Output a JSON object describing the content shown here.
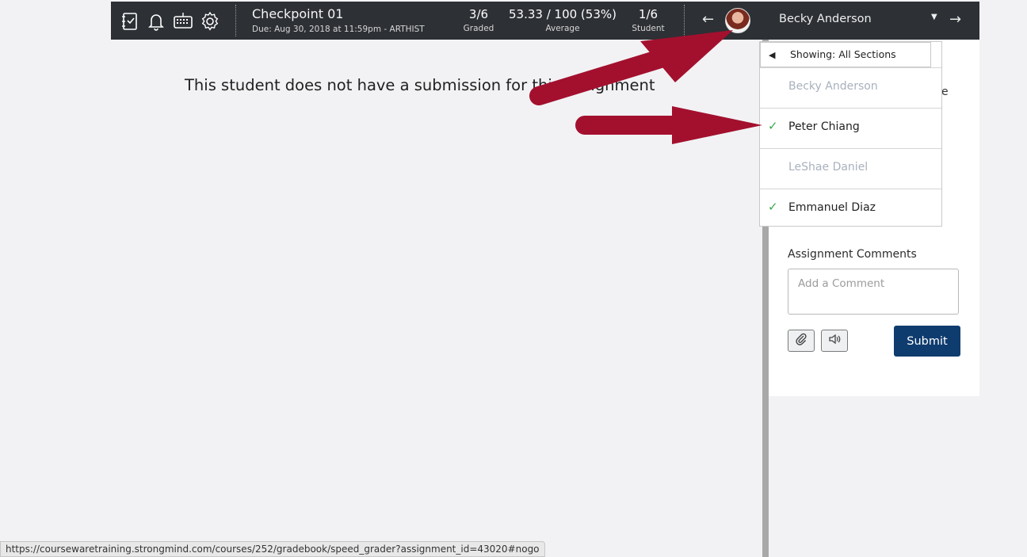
{
  "assignment": {
    "title": "Checkpoint 01",
    "due": "Due: Aug 30, 2018 at 11:59pm - ARTHIST"
  },
  "stats": [
    {
      "value": "3/6",
      "label": "Graded"
    },
    {
      "value": "53.33 / 100 (53%)",
      "label": "Average"
    },
    {
      "value": "1/6",
      "label": "Student"
    }
  ],
  "student": {
    "name": "Becky Anderson"
  },
  "main": {
    "message": "This student does not have a submission for this assignment"
  },
  "dropdown": {
    "header": "Showing: All Sections",
    "items": [
      {
        "name": "Becky Anderson",
        "checked": false,
        "dim": true
      },
      {
        "name": "Peter Chiang",
        "checked": true,
        "dim": false
      },
      {
        "name": "LeShae Daniel",
        "checked": false,
        "dim": true
      },
      {
        "name": "Emmanuel Diaz",
        "checked": true,
        "dim": false
      }
    ]
  },
  "comments": {
    "label": "Assignment Comments",
    "placeholder": "Add a Comment",
    "submit_label": "Submit"
  },
  "right_panel": {
    "partial_text": "e"
  },
  "statusbar": {
    "url": "https://coursewaretraining.strongmind.com/courses/252/gradebook/speed_grader?assignment_id=43020#nogo"
  },
  "colors": {
    "topbar": "#2d3035",
    "submit": "#0f3c6e",
    "check": "#3aa84a",
    "annotation_arrow": "#a3102e"
  },
  "icons": [
    "gradebook-icon",
    "bell-icon",
    "keyboard-icon",
    "gear-icon",
    "arrow-left-icon",
    "arrow-right-icon",
    "check-icon",
    "paperclip-icon",
    "speaker-icon",
    "triangle-left-icon",
    "caret-down-icon"
  ]
}
